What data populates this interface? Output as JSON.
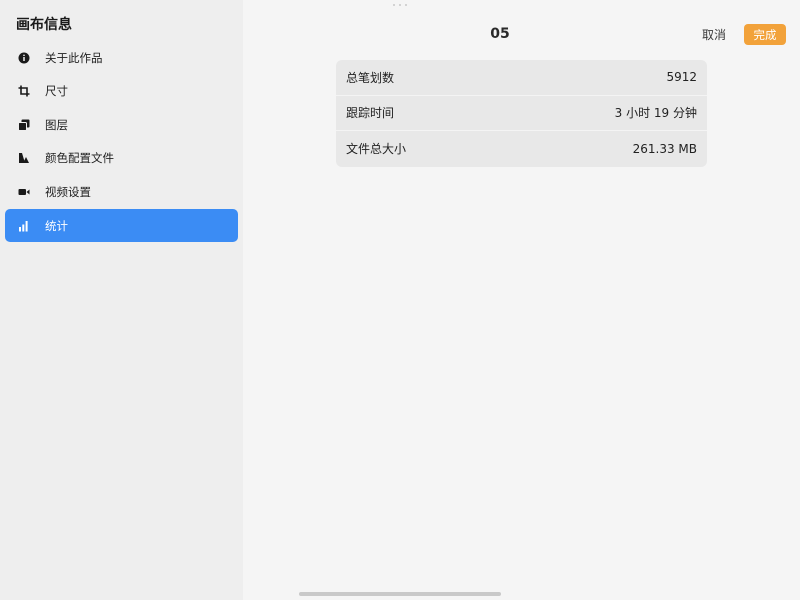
{
  "sidebar": {
    "title": "画布信息",
    "items": [
      {
        "label": "关于此作品",
        "icon": "info-icon"
      },
      {
        "label": "尺寸",
        "icon": "crop-icon"
      },
      {
        "label": "图层",
        "icon": "layers-icon"
      },
      {
        "label": "颜色配置文件",
        "icon": "color-profile-icon"
      },
      {
        "label": "视频设置",
        "icon": "video-camera-icon"
      },
      {
        "label": "统计",
        "icon": "bar-chart-icon",
        "active": true
      }
    ]
  },
  "header": {
    "title": "05",
    "cancel_label": "取消",
    "done_label": "完成"
  },
  "stats": [
    {
      "label": "总笔划数",
      "value": "5912"
    },
    {
      "label": "跟踪时间",
      "value": "3 小时 19 分钟"
    },
    {
      "label": "文件总大小",
      "value": "261.33 MB"
    }
  ],
  "colors": {
    "accent": "#3b8cf4",
    "done_button": "#f2a23a"
  }
}
